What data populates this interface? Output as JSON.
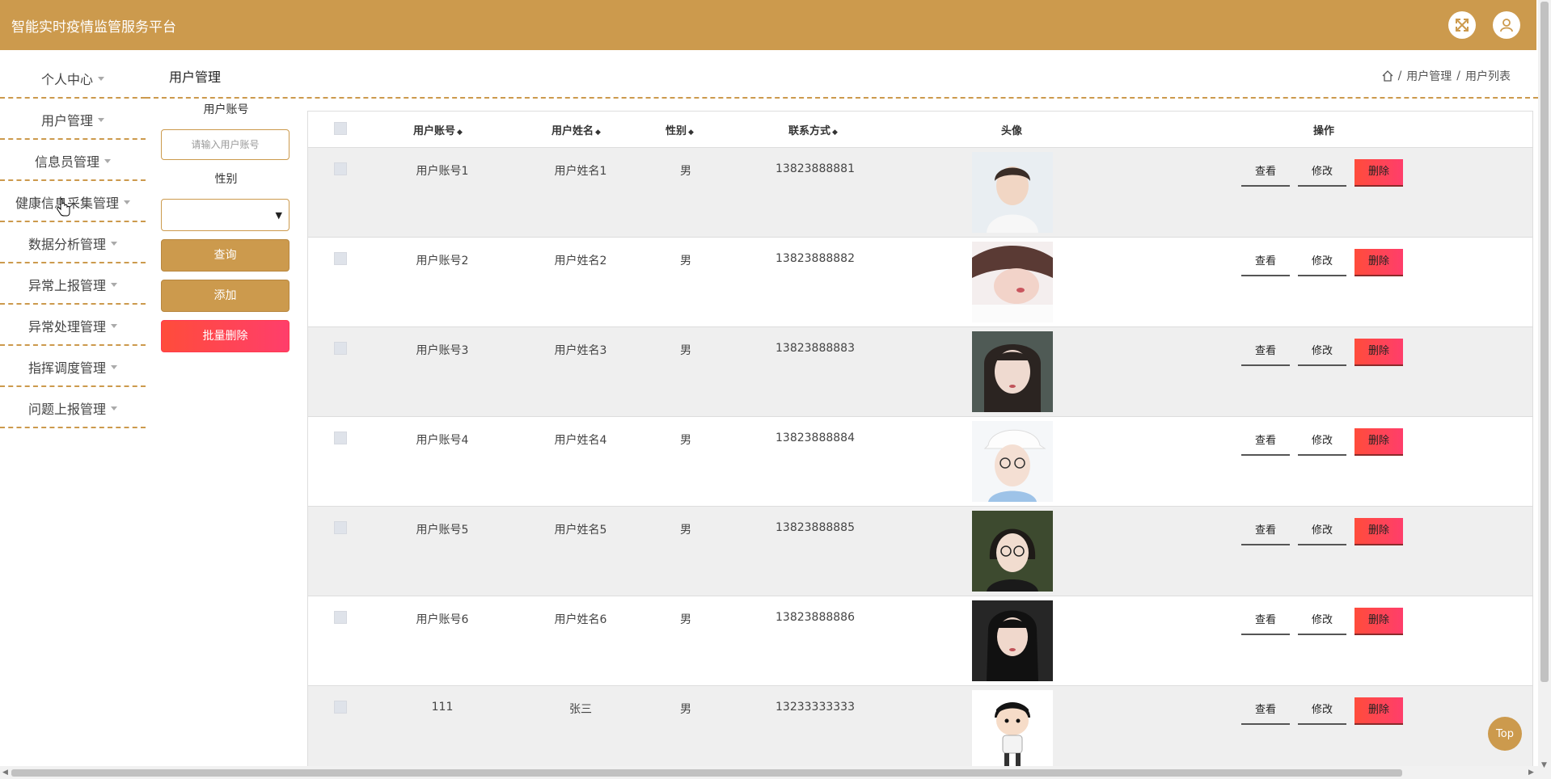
{
  "app": {
    "title": "智能实时疫情监管服务平台"
  },
  "header": {
    "fullscreen_icon": "expand-icon",
    "user_icon": "user-icon"
  },
  "sidebar": {
    "items": [
      {
        "label": "个人中心"
      },
      {
        "label": "用户管理"
      },
      {
        "label": "信息员管理"
      },
      {
        "label": "健康信息采集管理"
      },
      {
        "label": "数据分析管理"
      },
      {
        "label": "异常上报管理"
      },
      {
        "label": "异常处理管理"
      },
      {
        "label": "指挥调度管理"
      },
      {
        "label": "问题上报管理"
      }
    ]
  },
  "page": {
    "title": "用户管理",
    "breadcrumb": {
      "home_icon": "home-icon",
      "sep": "/",
      "level1": "用户管理",
      "level2": "用户列表"
    }
  },
  "filter": {
    "account_label": "用户账号",
    "account_placeholder": "请输入用户账号",
    "gender_label": "性别",
    "gender_value": "",
    "query_button": "查询",
    "add_button": "添加",
    "batch_delete_button": "批量删除"
  },
  "table": {
    "headers": {
      "account": "用户账号",
      "name": "用户姓名",
      "gender": "性别",
      "phone": "联系方式",
      "avatar": "头像",
      "actions": "操作"
    },
    "sort_icon": "◆",
    "rows": [
      {
        "account": "用户账号1",
        "name": "用户姓名1",
        "gender": "男",
        "phone": "13823888881"
      },
      {
        "account": "用户账号2",
        "name": "用户姓名2",
        "gender": "男",
        "phone": "13823888882"
      },
      {
        "account": "用户账号3",
        "name": "用户姓名3",
        "gender": "男",
        "phone": "13823888883"
      },
      {
        "account": "用户账号4",
        "name": "用户姓名4",
        "gender": "男",
        "phone": "13823888884"
      },
      {
        "account": "用户账号5",
        "name": "用户姓名5",
        "gender": "男",
        "phone": "13823888885"
      },
      {
        "account": "用户账号6",
        "name": "用户姓名6",
        "gender": "男",
        "phone": "13823888886"
      },
      {
        "account": "111",
        "name": "张三",
        "gender": "男",
        "phone": "13233333333"
      }
    ],
    "actions": {
      "view": "查看",
      "edit": "修改",
      "delete": "删除"
    }
  },
  "back_to_top": "Top",
  "colors": {
    "brand": "#cc9a4d",
    "danger": "#ff4c3b"
  }
}
